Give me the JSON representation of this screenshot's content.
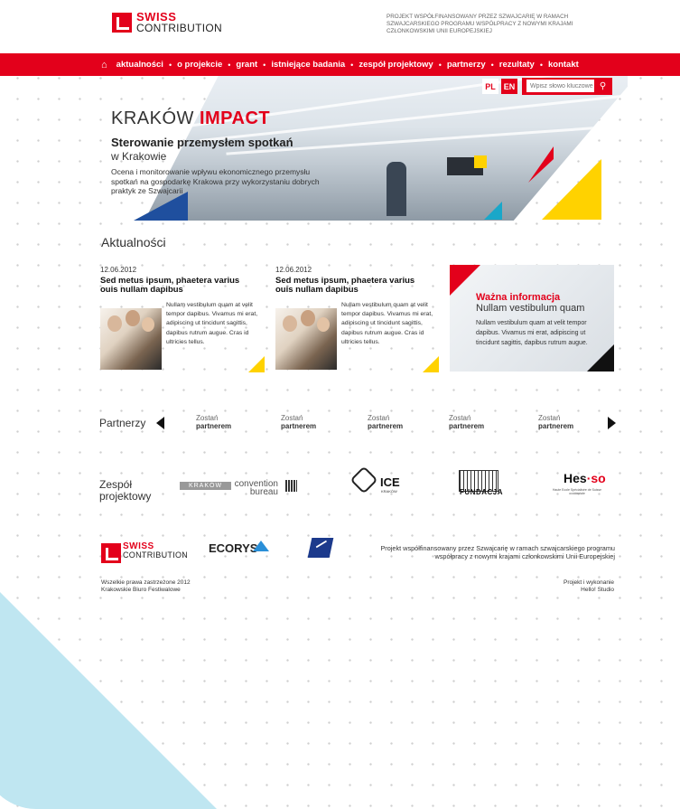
{
  "header": {
    "logo_line1": "SWISS",
    "logo_line2": "CONTRIBUTION",
    "project_note": "PROJEKT WSPÓŁFINANSOWANY PRZEZ SZWAJCARIĘ W RAMACH SZWAJCARSKIEGO PROGRAMU WSPÓŁPRACY Z NOWYMI KRAJAMI CZŁONKOWSKIMI UNII EUROPEJSKIEJ"
  },
  "nav": {
    "home_icon": "home-icon",
    "items": [
      "aktualności",
      "o projekcie",
      "grant",
      "istniejące badania",
      "zespół projektowy",
      "partnerzy",
      "rezultaty",
      "kontakt"
    ]
  },
  "hero": {
    "title_plain": "KRAKÓW ",
    "title_bold": "IMPACT",
    "subtitle": "Sterowanie przemysłem spotkań",
    "subtitle2": "w Krakowie",
    "description": "Ocena i monitorowanie wpływu ekonomicznego przemysłu spotkań na gospodarkę Krakowa przy wykorzystaniu dobrych praktyk ze Szwajcarii"
  },
  "lang": {
    "pl": "PL",
    "en": "EN",
    "colors": {
      "active": "#e3001b",
      "inactive": "#e3001b"
    }
  },
  "search": {
    "placeholder": "Wpisz słowo kluczowe",
    "icon": "search-icon"
  },
  "news": {
    "section_title": "Aktualności",
    "items": [
      {
        "date": "12.06.2012",
        "title": "Sed metus ipsum, phaetera varius ouis nullam dapibus",
        "body": "Nullam vestibulum quam at velit tempor dapibus. Vivamus mi erat, adipiscing ut tincidunt sagittis, dapibus rutrum augue. Cras id ultricies tellus."
      },
      {
        "date": "12.06.2012",
        "title": "Sed metus ipsum, phaetera varius ouis nullam dapibus",
        "body": "Nullam vestibulum quam at velit tempor dapibus. Vivamus mi erat, adipiscing ut tincidunt sagittis, dapibus rutrum augue. Cras id ultricies tellus."
      }
    ]
  },
  "info": {
    "title": "Ważna informacja",
    "subtitle": "Nullam vestibulum quam",
    "body": "Nullam vestibulum quam at velit tempor dapibus. Vivamus mi erat, adipiscing ut tincidunt sagittis, dapibus rutrum augue."
  },
  "partners": {
    "title": "Partnerzy",
    "slots": [
      {
        "l1": "Zostań",
        "l2": "partnerem"
      },
      {
        "l1": "Zostań",
        "l2": "partnerem"
      },
      {
        "l1": "Zostań",
        "l2": "partnerem"
      },
      {
        "l1": "Zostań",
        "l2": "partnerem"
      },
      {
        "l1": "Zostań",
        "l2": "partnerem"
      }
    ]
  },
  "team": {
    "title_l1": "Zespół",
    "title_l2": "projektowy",
    "krakow": "KRAKÓW",
    "convention": "convention bureau",
    "ice": "ICE",
    "ice_sub": "KRAKÓW",
    "fundacja": "FUNDACJA",
    "hes": "Hes",
    "hes_suffix": "·so",
    "hes_sub": "Haute Ecole Spécialisée de Suisse occidentale"
  },
  "footer": {
    "logo_line1": "SWISS",
    "logo_line2": "CONTRIBUTION",
    "ecorys": "ECORYS",
    "note": "Projekt współfinansowany przez Szwajcarię w ramach szwajcarskiego programu współpracy z nowymi krajami członkowskimi Unii Europejskiej",
    "copy_l1": "Wszelkie prawa zastrzeżone 2012",
    "copy_l2": "Krakowskie Biuro Festiwalowe",
    "credit_l1": "Projekt i wykonanie",
    "credit_l2": "Hello! Studio"
  }
}
